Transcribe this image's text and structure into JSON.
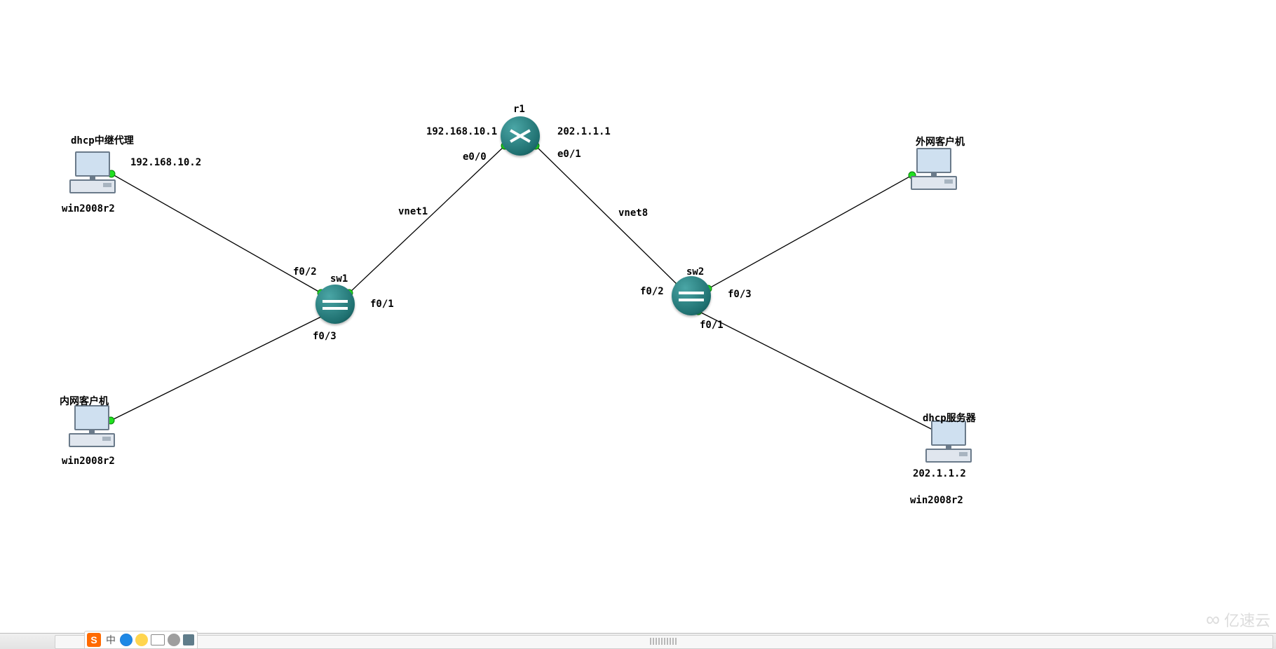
{
  "devices": {
    "r1": {
      "name": "r1",
      "type": "router"
    },
    "sw1": {
      "name": "sw1",
      "type": "switch"
    },
    "sw2": {
      "name": "sw2",
      "type": "switch"
    }
  },
  "hosts": {
    "proxy": {
      "title": "dhcp中继代理",
      "ip": "192.168.10.2",
      "os": "win2008r2"
    },
    "client_in": {
      "title": "内网客户机",
      "os": "win2008r2"
    },
    "client_out": {
      "title": "外网客户机"
    },
    "dhcp_srv": {
      "title": "dhcp服务器",
      "ip": "202.1.1.2",
      "os": "win2008r2"
    }
  },
  "router_if": {
    "left": {
      "ip": "192.168.10.1",
      "port": "e0/0"
    },
    "right": {
      "ip": "202.1.1.1",
      "port": "e0/1"
    }
  },
  "links": {
    "vnet_left": "vnet1",
    "vnet_right": "vnet8"
  },
  "ports": {
    "sw1_f01": "f0/1",
    "sw1_f02": "f0/2",
    "sw1_f03": "f0/3",
    "sw2_f01": "f0/1",
    "sw2_f02": "f0/2",
    "sw2_f03": "f0/3"
  },
  "watermark": "亿速云",
  "ime": {
    "logo": "S",
    "cn": "中"
  }
}
